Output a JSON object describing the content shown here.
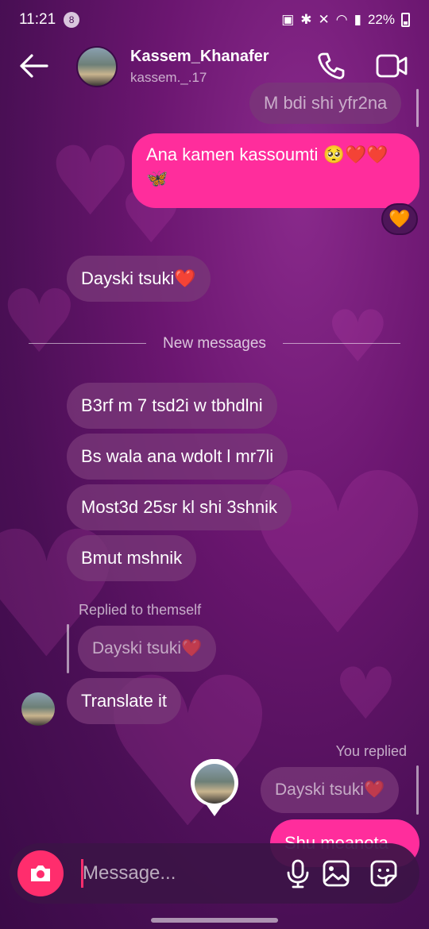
{
  "status_bar": {
    "time": "11:21",
    "notification_count": "8",
    "battery": "22%"
  },
  "header": {
    "name": "Kassem_Khanafer",
    "username": "kassem._.17"
  },
  "messages": {
    "top_partial": "M bdi shi yfr2na",
    "sent_1": "Ana kamen kassoumti 🥺❤️❤️🦋",
    "sent_1_reaction": "🧡",
    "recv_1": "Dayski tsuki❤️",
    "new_messages_label": "New messages",
    "recv_2": "B3rf m 7 tsd2i w tbhdlni",
    "recv_3": "Bs wala ana wdolt l mr7li",
    "recv_4": "Most3d 25sr kl shi 3shnik",
    "recv_5": "Bmut mshnik",
    "replied_label": "Replied to themself",
    "quoted_1": "Dayski tsuki❤️",
    "recv_6": "Translate it",
    "you_replied_label": "You replied",
    "quoted_2": "Dayski tsuki❤️",
    "sent_2_partial": "Shu meanota"
  },
  "composer": {
    "placeholder": "Message..."
  },
  "icons": {
    "back": "arrow-left-icon",
    "call": "phone-icon",
    "video": "video-camera-icon",
    "camera": "camera-icon",
    "mic": "microphone-icon",
    "gallery": "image-icon",
    "sticker": "sticker-icon"
  },
  "colors": {
    "sent_bubble": "#ff2d9c",
    "camera_button": "#ff2d6d",
    "received_bubble": "#783778"
  }
}
